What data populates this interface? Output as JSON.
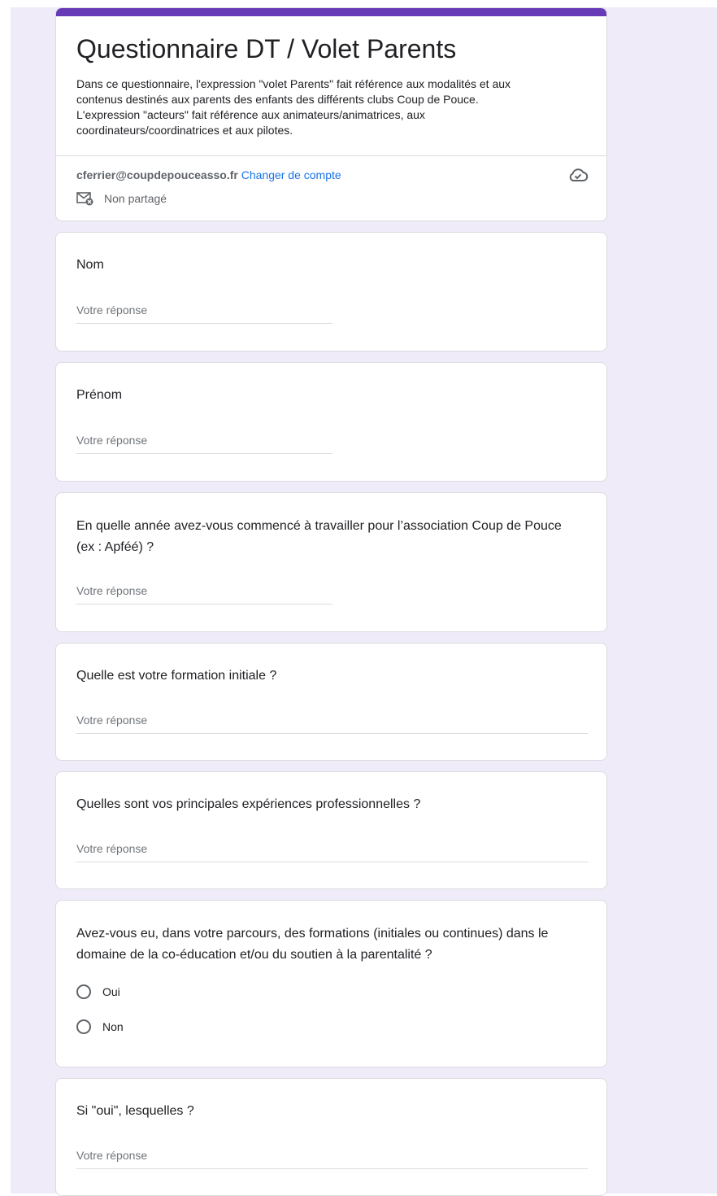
{
  "form": {
    "title": "Questionnaire DT / Volet Parents",
    "description": "Dans ce questionnaire, l'expression \"volet Parents\" fait référence aux modalités et aux\ncontenus destinés aux parents des enfants des différents clubs Coup de Pouce.\nL'expression \"acteurs\" fait référence aux animateurs/animatrices, aux\ncoordinateurs/coordinatrices et aux pilotes.",
    "accent_color": "#673ab7",
    "background_color": "#efebf9"
  },
  "account": {
    "email": "cferrier@coupdepouceasso.fr",
    "switch_label": "Changer de compte",
    "shared_label": "Non partagé",
    "shared_icon": "mail-not-shared-icon",
    "saved_icon": "cloud-saved-icon"
  },
  "questions": [
    {
      "title": "Nom",
      "answer_placeholder": "Votre réponse"
    },
    {
      "title": "Prénom",
      "answer_placeholder": "Votre réponse"
    },
    {
      "title": "En quelle année avez-vous commencé à travailler pour l’association Coup de Pouce\n(ex : Apféé) ?",
      "answer_placeholder": "Votre réponse"
    },
    {
      "title": "Quelle est votre formation initiale ?",
      "answer_placeholder": "Votre réponse"
    },
    {
      "title": "Quelles sont vos principales expériences professionnelles ?",
      "answer_placeholder": "Votre réponse"
    },
    {
      "title": "Avez-vous eu, dans votre parcours, des formations (initiales ou continues) dans le\ndomaine de la co-éducation et/ou du soutien à la parentalité ?",
      "options": [
        "Oui",
        "Non"
      ]
    },
    {
      "title": "Si \"oui\", lesquelles ?",
      "answer_placeholder": "Votre réponse"
    }
  ]
}
